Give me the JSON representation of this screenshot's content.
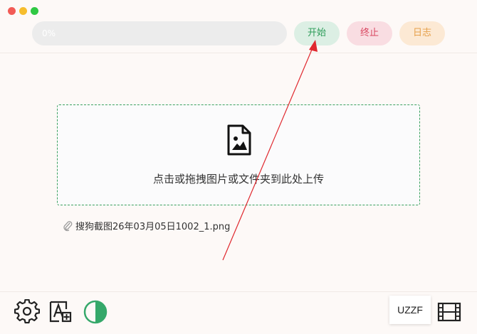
{
  "window": {
    "traffic_lights": [
      "close",
      "minimize",
      "maximize"
    ]
  },
  "progress": {
    "value": 0,
    "text": "0%"
  },
  "toolbar": {
    "start_label": "开始",
    "stop_label": "终止",
    "log_label": "日志"
  },
  "dropzone": {
    "icon": "file-image-icon",
    "text": "点击或拖拽图片或文件夹到此处上传"
  },
  "files": [
    {
      "name": "搜狗截图26年03月05日1002_1.png",
      "icon": "paperclip-icon"
    }
  ],
  "bottom_bar": {
    "left_icons": [
      "settings-icon",
      "font-icon",
      "theme-toggle-icon"
    ],
    "watermark": "UZZF",
    "right_icon": "film-icon"
  },
  "colors": {
    "background": "#fdf9f7",
    "accent_green": "#2e9c5a",
    "stop_red": "#d9455f",
    "log_orange": "#e6a04a",
    "annotation_arrow": "#e0282e"
  }
}
